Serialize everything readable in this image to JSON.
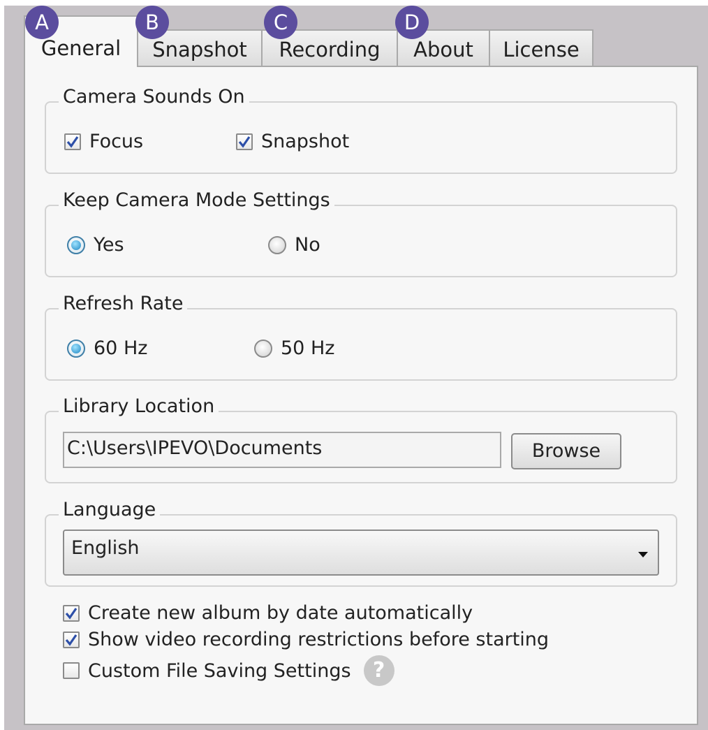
{
  "badges": [
    "A",
    "B",
    "C",
    "D"
  ],
  "tabs": [
    {
      "label": "General",
      "active": true
    },
    {
      "label": "Snapshot"
    },
    {
      "label": "Recording"
    },
    {
      "label": "About"
    },
    {
      "label": "License"
    }
  ],
  "camera_sounds": {
    "title": "Camera Sounds On",
    "focus": {
      "label": "Focus",
      "checked": true
    },
    "snapshot": {
      "label": "Snapshot",
      "checked": true
    }
  },
  "keep_mode": {
    "title": "Keep Camera Mode Settings",
    "yes": {
      "label": "Yes",
      "selected": true
    },
    "no": {
      "label": "No",
      "selected": false
    }
  },
  "refresh_rate": {
    "title": "Refresh Rate",
    "hz60": {
      "label": "60 Hz",
      "selected": true
    },
    "hz50": {
      "label": "50 Hz",
      "selected": false
    }
  },
  "library": {
    "title": "Library Location",
    "path": "C:\\Users\\IPEVO\\Documents",
    "browse_label": "Browse"
  },
  "language": {
    "title": "Language",
    "selected": "English"
  },
  "options": {
    "album": {
      "label": "Create new album by date automatically",
      "checked": true
    },
    "restrictions": {
      "label": "Show video recording restrictions before starting",
      "checked": true
    },
    "custom": {
      "label": "Custom File Saving Settings",
      "checked": false
    }
  },
  "icons": {
    "help": "question-circle-icon",
    "checkmark": "checkmark-icon",
    "dropdown": "chevron-down-icon"
  },
  "colors": {
    "badge": "#5b4d9e",
    "check": "#2d4fa8",
    "radio": "#2087c3"
  }
}
